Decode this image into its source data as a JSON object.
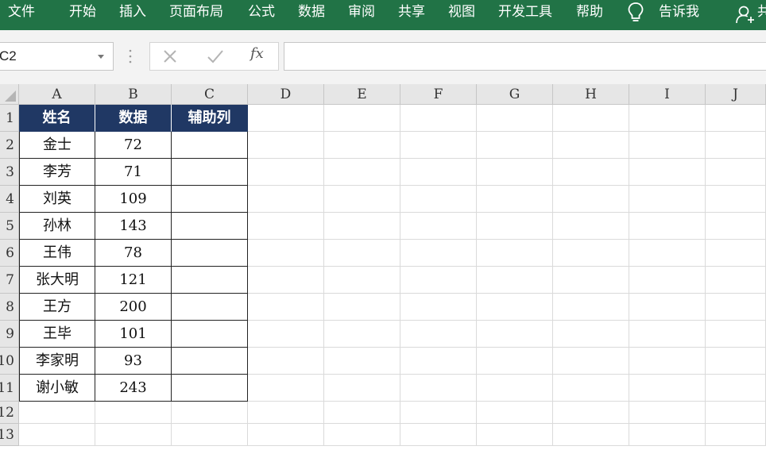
{
  "ribbon": {
    "tabs": [
      "文件",
      "开始",
      "插入",
      "页面布局",
      "公式",
      "数据",
      "审阅",
      "共享",
      "视图",
      "开发工具",
      "帮助"
    ],
    "tell_me": "告诉我",
    "share_partial": "共"
  },
  "formula_bar": {
    "name_box": "C2",
    "fx_label": "fx",
    "formula": ""
  },
  "sheet": {
    "columns": [
      "A",
      "B",
      "C",
      "D",
      "E",
      "F",
      "G",
      "H",
      "I",
      "J"
    ],
    "rows": [
      "1",
      "2",
      "3",
      "4",
      "5",
      "6",
      "7",
      "8",
      "9",
      "10",
      "11",
      "12",
      "13"
    ],
    "table_header": [
      "姓名",
      "数据",
      "辅助列"
    ],
    "table_rows": [
      [
        "金士",
        "72",
        ""
      ],
      [
        "李芳",
        "71",
        ""
      ],
      [
        "刘英",
        "109",
        ""
      ],
      [
        "孙林",
        "143",
        ""
      ],
      [
        "王伟",
        "78",
        ""
      ],
      [
        "张大明",
        "121",
        ""
      ],
      [
        "王方",
        "200",
        ""
      ],
      [
        "王毕",
        "101",
        ""
      ],
      [
        "李家明",
        "93",
        ""
      ],
      [
        "谢小敏",
        "243",
        ""
      ]
    ]
  },
  "colors": {
    "ribbon": "#217346",
    "table_header_bg": "#203864",
    "table_header_text": "#ffffff"
  }
}
